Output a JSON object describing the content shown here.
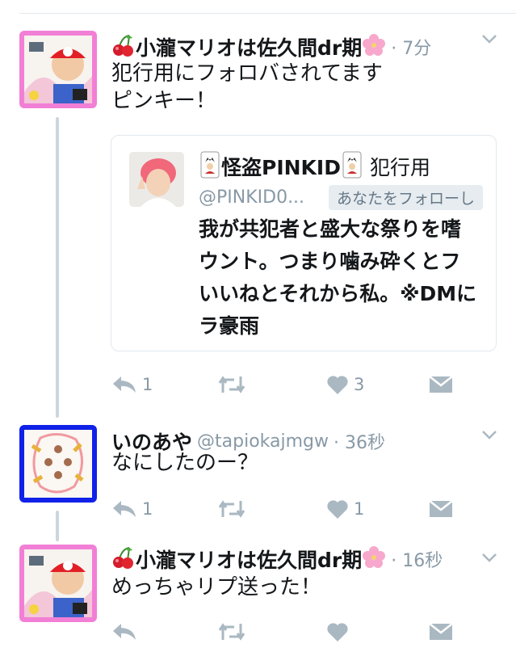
{
  "tweets": [
    {
      "name": "小瀧マリオは佐久間dr期",
      "time": "· 7分",
      "text_lines": [
        "犯行用にフォロバされてます",
        "ピンキー！"
      ],
      "avatar_border": "#f27fd6",
      "actions": {
        "reply": "1",
        "retweet": "",
        "like": "3"
      },
      "quote": {
        "name": "怪盗PINKID",
        "name_suffix": "犯行用",
        "handle": "@PINKID0...",
        "badge": "あなたをフォローし",
        "text_lines": [
          "我が共犯者と盛大な祭りを嗜",
          "ウント。つまり噛み砕くとフ",
          "いいねとそれから私。※DMに",
          "ラ豪雨"
        ]
      }
    },
    {
      "name": "いのあや",
      "handle": "@tapiokajmgw",
      "time": "· 36秒",
      "text_lines": [
        "なにしたのー？"
      ],
      "avatar_border": "#1021e8",
      "actions": {
        "reply": "1",
        "retweet": "",
        "like": "1"
      }
    },
    {
      "name": "小瀧マリオは佐久間dr期",
      "time": "· 16秒",
      "text_lines": [
        "めっちゃリプ送った！"
      ],
      "avatar_border": "#f27fd6",
      "actions": {
        "reply": "",
        "retweet": "",
        "like": ""
      }
    }
  ],
  "icons": {
    "cherry": "cherry-emoji-icon",
    "blossom": "cherry-blossom-emoji-icon",
    "joker": "joker-card-icon",
    "reply": "reply-icon",
    "retweet": "retweet-icon",
    "like": "heart-icon",
    "dm": "envelope-icon",
    "more": "chevron-down-icon"
  },
  "colors": {
    "icon_gray": "#aab8c2",
    "text_gray": "#8899a6",
    "thread_line": "#ccd6dd"
  }
}
